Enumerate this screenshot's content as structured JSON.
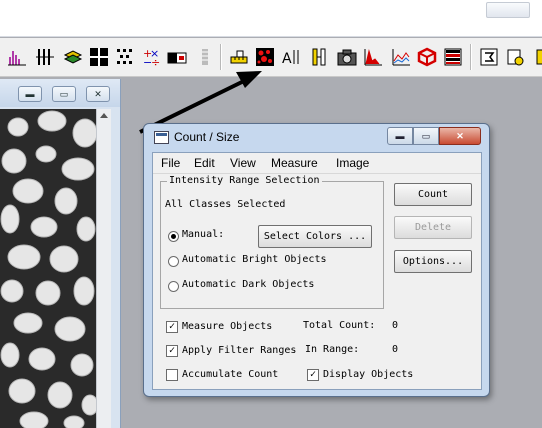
{
  "image_window": {
    "minimize": "▬",
    "restore": "▭",
    "close": "✕"
  },
  "toolbar": {
    "icons": [
      "histogram-icon",
      "hash-grid-icon",
      "layers-icon",
      "cross-grid-icon",
      "pixel-grid-icon",
      "plus-minus-icon",
      "contrast-icon",
      "dotted-bar-icon",
      "ruler-icon",
      "count-size-icon",
      "angle-text-icon",
      "caliper-icon",
      "camera-icon",
      "profile-chart-icon",
      "line-chart-icon",
      "cube-icon",
      "color-bars-icon",
      "settings-icon",
      "macro-icon"
    ]
  },
  "dialog": {
    "title": "Count / Size",
    "menu": [
      "File",
      "Edit",
      "View",
      "Measure",
      "Image"
    ],
    "group_title": "Intensity Range Selection",
    "all_classes": "All Classes Selected",
    "radio_manual": "Manual:",
    "radio_bright": "Automatic Bright Objects",
    "radio_dark": "Automatic Dark Objects",
    "select_colors": "Select Colors ...",
    "count_btn": "Count",
    "delete_btn": "Delete",
    "options_btn": "Options...",
    "measure_objects": "Measure Objects",
    "apply_filter": "Apply Filter Ranges",
    "accumulate": "Accumulate Count",
    "display_objects": "Display Objects",
    "total_count_label": "Total Count:",
    "total_count_value": "0",
    "in_range_label": "In Range:",
    "in_range_value": "0",
    "check_mark": "✓"
  },
  "colors": {
    "dialog_frame": "#c6d8ee",
    "close_button": "#c94b32",
    "arrow": "#000000"
  }
}
